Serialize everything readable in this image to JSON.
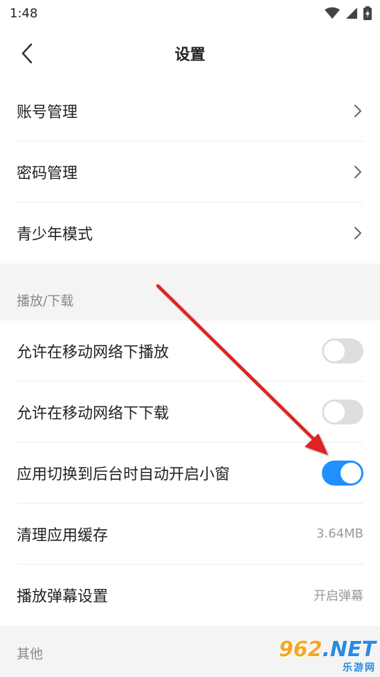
{
  "status_bar": {
    "time": "1:48"
  },
  "header": {
    "title": "设置"
  },
  "account_group": {
    "items": [
      {
        "label": "账号管理"
      },
      {
        "label": "密码管理"
      },
      {
        "label": "青少年模式"
      }
    ]
  },
  "playback_section": {
    "header": "播放/下载",
    "items": [
      {
        "label": "允许在移动网络下播放",
        "toggle": "off"
      },
      {
        "label": "允许在移动网络下下载",
        "toggle": "off"
      },
      {
        "label": "应用切换到后台时自动开启小窗",
        "toggle": "on"
      },
      {
        "label": "清理应用缓存",
        "value": "3.64MB"
      },
      {
        "label": "播放弹幕设置",
        "value": "开启弹幕"
      }
    ]
  },
  "other_section": {
    "header": "其他"
  },
  "watermark": {
    "brand": "962",
    "suffix": ".NET",
    "subtitle": "乐游网"
  },
  "colors": {
    "accent": "#1e90ff",
    "annotation_arrow": "#e02020"
  }
}
